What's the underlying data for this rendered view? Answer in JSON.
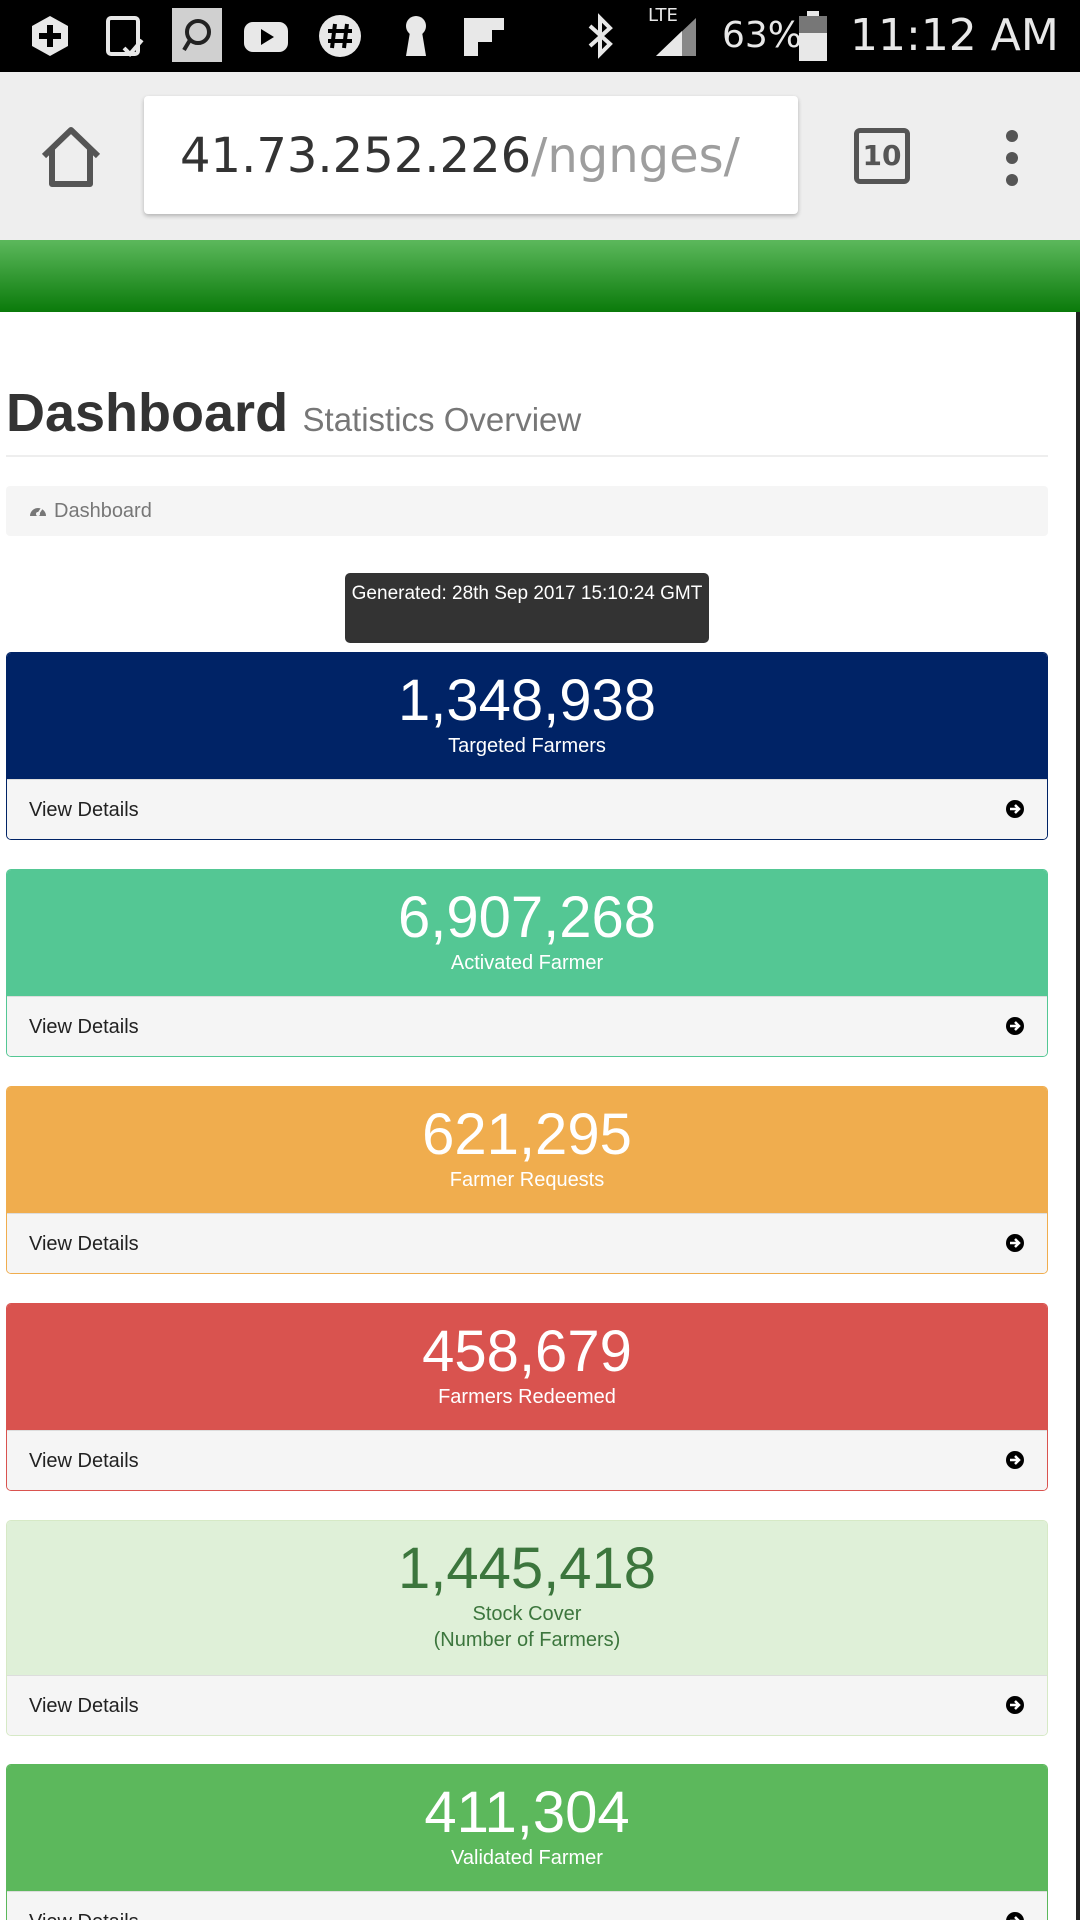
{
  "status_bar": {
    "network": "LTE",
    "battery": "63%",
    "time": "11:12 AM",
    "notification_icons": [
      "add-box-icon",
      "tablet-check-icon",
      "chat-icon",
      "youtube-icon",
      "slack-icon",
      "keyhole-icon",
      "flipboard-icon",
      "bluetooth-icon",
      "signal-icon",
      "battery-icon"
    ]
  },
  "browser": {
    "url_host": "41.73.252.226",
    "url_path": "/ngnges/",
    "tab_count": "10"
  },
  "colors": {
    "header_green": "#0a7a0a",
    "navy": "#002366",
    "teal": "#54c794",
    "orange": "#f0ad4e",
    "red": "#d9534f",
    "light_green": "#dff0d8",
    "green": "#5cb85c"
  },
  "page": {
    "title": "Dashboard",
    "subtitle": "Statistics Overview",
    "breadcrumb": "Dashboard",
    "generated": "Generated: 28th Sep 2017 15:10:24 GMT"
  },
  "panels": [
    {
      "value": "1,348,938",
      "label": "Targeted Farmers",
      "link": "View Details"
    },
    {
      "value": "6,907,268",
      "label": "Activated Farmer",
      "link": "View Details"
    },
    {
      "value": "621,295",
      "label": "Farmer Requests",
      "link": "View Details"
    },
    {
      "value": "458,679",
      "label": "Farmers Redeemed",
      "link": "View Details"
    },
    {
      "value": "1,445,418",
      "label": "Stock Cover",
      "sublabel": "(Number of Farmers)",
      "link": "View Details"
    },
    {
      "value": "411,304",
      "label": "Validated Farmer",
      "link": "View Details"
    }
  ]
}
